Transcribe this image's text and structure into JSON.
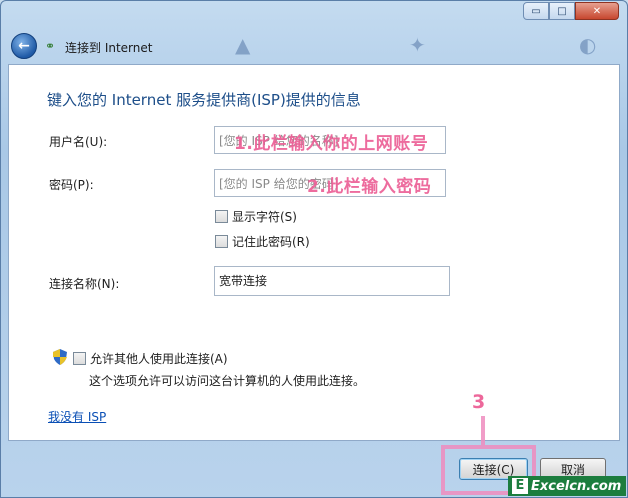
{
  "window": {
    "title": "",
    "caption": {
      "minimize": "▭",
      "maximize": "□",
      "close": "✕"
    }
  },
  "nav": {
    "back_icon": "←",
    "title": "连接到 Internet"
  },
  "main": {
    "heading": "键入您的 Internet 服务提供商(ISP)提供的信息",
    "username": {
      "label": "用户名(U):",
      "placeholder": "[您的 ISP 给您的名称]"
    },
    "password": {
      "label": "密码(P):",
      "placeholder": "[您的 ISP 给您的密码]"
    },
    "show_chars": "显示字符(S)",
    "remember_pw": "记住此密码(R)",
    "conn_name": {
      "label": "连接名称(N):",
      "value": "宽带连接"
    },
    "allow_others": "允许其他人使用此连接(A)",
    "allow_note": "这个选项允许可以访问这台计算机的人使用此连接。",
    "no_isp_link": "我没有 ISP"
  },
  "annotations": {
    "step1": "1.此栏输入你的上网账号",
    "step2": "2.此栏输入密码",
    "step3": "3"
  },
  "buttons": {
    "connect": "连接(C)",
    "cancel": "取消"
  },
  "watermark": {
    "logo": "E",
    "text": "Excelcn.com"
  },
  "colors": {
    "heading": "#1d4e89",
    "link": "#0a4fb5",
    "annotation": "#ec6096",
    "watermark_bg": "#1c7d3e"
  }
}
